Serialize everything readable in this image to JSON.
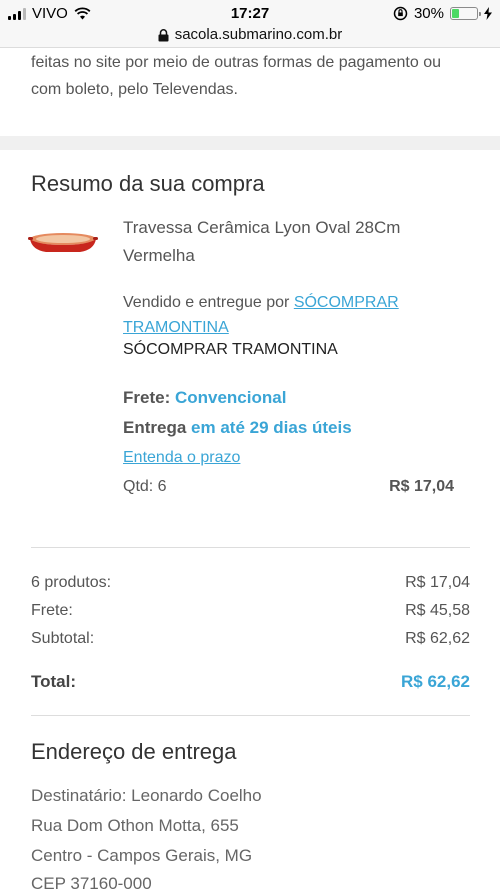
{
  "status_bar": {
    "carrier": "VIVO",
    "time": "17:27",
    "battery_percent": "30%",
    "battery_level": 0.3,
    "battery_color": "#4cd964"
  },
  "url_bar": {
    "url": "sacola.submarino.com.br"
  },
  "top_text": "feitas no site por meio de outras formas de pagamento ou com boleto, pelo Televendas.",
  "summary": {
    "title": "Resumo da sua compra",
    "product_name": "Travessa Cerâmica Lyon Oval 28Cm Vermelha",
    "sold_by_label": "Vendido e entregue por",
    "seller_link": "SÓCOMPRAR TRAMONTINA",
    "seller_name": "SÓCOMPRAR TRAMONTINA",
    "frete_label": "Frete:",
    "frete_value": "Convencional",
    "entrega_label": "Entrega",
    "entrega_value": "em até 29 dias úteis",
    "prazo_link": "Entenda o prazo",
    "qty": "Qtd: 6",
    "item_price": "R$ 17,04"
  },
  "totals": {
    "rows": [
      {
        "label": "6 produtos:",
        "value": "R$ 17,04"
      },
      {
        "label": "Frete:",
        "value": "R$ 45,58"
      },
      {
        "label": "Subtotal:",
        "value": "R$ 62,62"
      }
    ],
    "total_label": "Total:",
    "total_value": "R$ 62,62"
  },
  "address": {
    "title": "Endereço de entrega",
    "lines": [
      "Destinatário: Leonardo Coelho",
      "Rua Dom Othon Motta, 655",
      "Centro - Campos Gerais, MG",
      "CEP 37160-000"
    ]
  },
  "colors": {
    "accent": "#3aa5d6",
    "dish": "#c8261d"
  }
}
